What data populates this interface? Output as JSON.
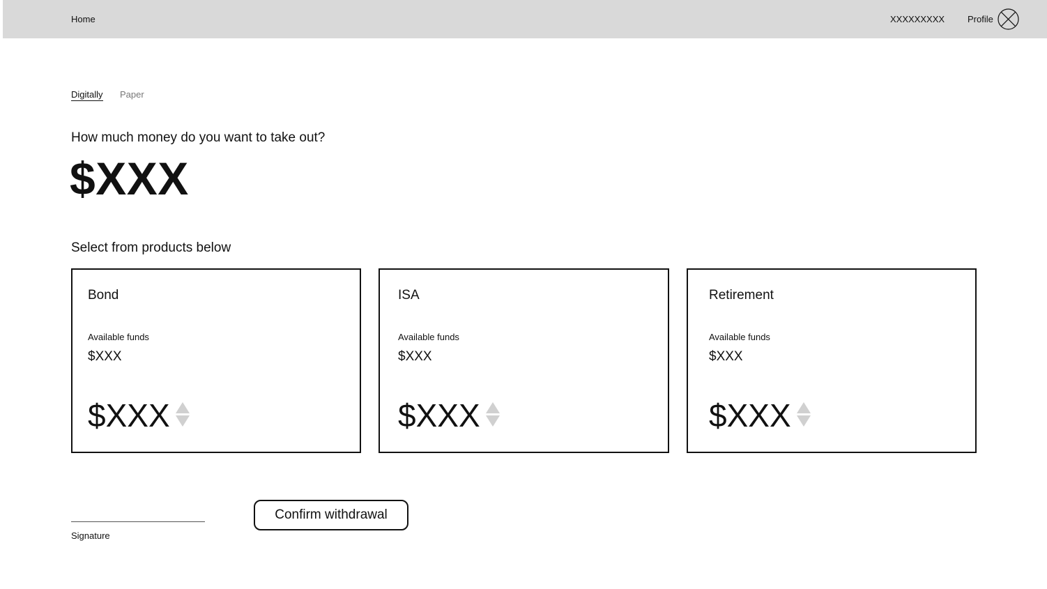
{
  "header": {
    "home_label": "Home",
    "account_id": "XXXXXXXXX",
    "profile_label": "Profile",
    "avatar_icon": "avatar-placeholder-icon"
  },
  "tabs": [
    {
      "label": "Digitally",
      "active": true
    },
    {
      "label": "Paper",
      "active": false
    }
  ],
  "withdrawal": {
    "question": "How much money do you want to take out?",
    "total_amount": "$XXX"
  },
  "products": {
    "heading": "Select from products below",
    "items": [
      {
        "name": "Bond",
        "funds_label": "Available funds",
        "funds_value": "$XXX",
        "amount": "$XXX"
      },
      {
        "name": "ISA",
        "funds_label": "Available funds",
        "funds_value": "$XXX",
        "amount": "$XXX"
      },
      {
        "name": "Retirement",
        "funds_label": "Available funds",
        "funds_value": "$XXX",
        "amount": "$XXX"
      }
    ]
  },
  "signature": {
    "label": "Signature"
  },
  "confirm": {
    "label": "Confirm withdrawal"
  },
  "colors": {
    "header_bg": "#d9d9d9",
    "text": "#111111",
    "inactive_tab": "#777777",
    "stepper": "#d0d0d0"
  }
}
